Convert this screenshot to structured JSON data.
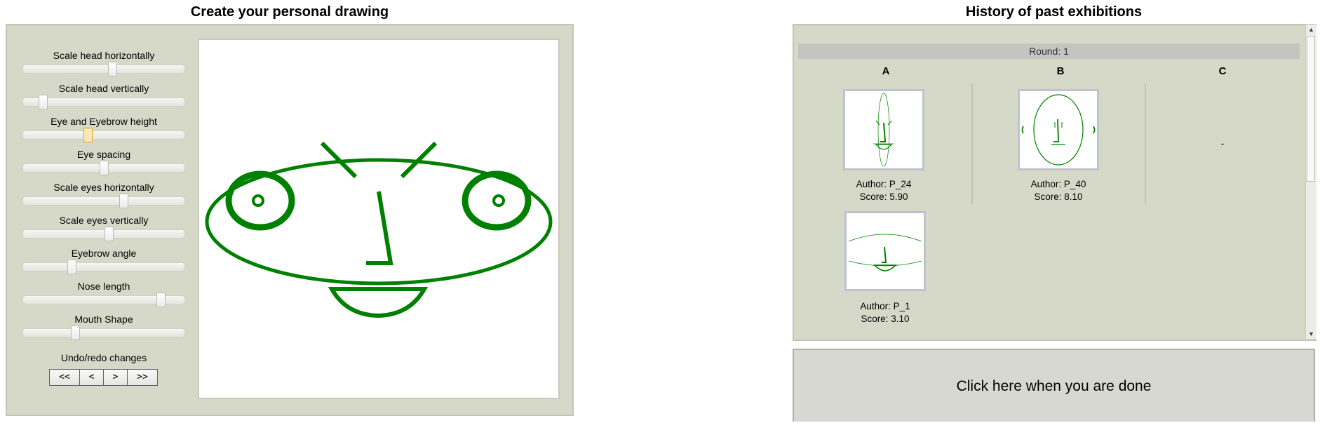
{
  "left": {
    "title": "Create your personal drawing",
    "sliders": [
      {
        "label": "Scale head horizontally",
        "value": 0.55
      },
      {
        "label": "Scale head vertically",
        "value": 0.12
      },
      {
        "label": "Eye and Eyebrow height",
        "value": 0.4,
        "active": true
      },
      {
        "label": "Eye spacing",
        "value": 0.5
      },
      {
        "label": "Scale eyes horizontally",
        "value": 0.62
      },
      {
        "label": "Scale eyes vertically",
        "value": 0.53
      },
      {
        "label": "Eyebrow angle",
        "value": 0.3
      },
      {
        "label": "Nose length",
        "value": 0.85
      },
      {
        "label": "Mouth Shape",
        "value": 0.32
      }
    ],
    "undo_label": "Undo/redo changes",
    "undo_buttons": [
      "<<",
      "<",
      ">",
      ">>"
    ],
    "face_color": "#008000"
  },
  "right": {
    "title": "History of past exhibitions",
    "round": "Round: 1",
    "columns": [
      "A",
      "B",
      "C"
    ],
    "empty_marker": "-",
    "entries": [
      {
        "author": "Author: P_24",
        "score": "Score: 5.90"
      },
      {
        "author": "Author: P_40",
        "score": "Score: 8.10"
      },
      {
        "author": "Author: P_1",
        "score": "Score: 3.10"
      }
    ],
    "done_button": "Click here when you are done"
  }
}
